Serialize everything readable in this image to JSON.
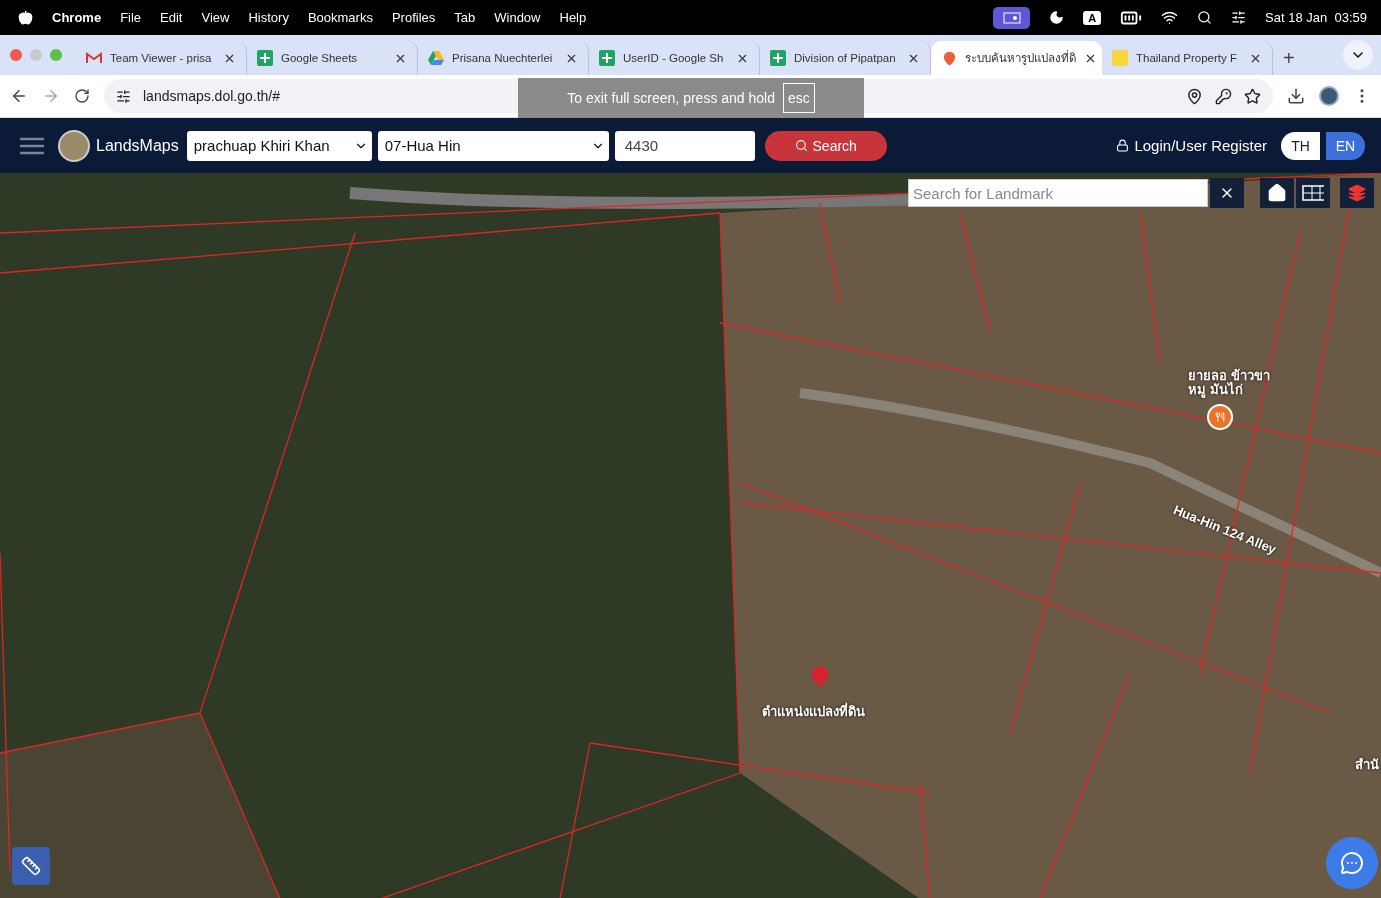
{
  "menubar": {
    "app": "Chrome",
    "menus": [
      "File",
      "Edit",
      "View",
      "History",
      "Bookmarks",
      "Profiles",
      "Tab",
      "Window",
      "Help"
    ],
    "input_badge": "A",
    "clock": "Sat 18 Jan  03:59"
  },
  "tabs": [
    {
      "kind": "gmail",
      "title": "Team Viewer - prisa",
      "selected": false
    },
    {
      "kind": "sheets",
      "title": "Google Sheets",
      "selected": false
    },
    {
      "kind": "drive",
      "title": "Prisana Nuechterlei",
      "selected": false
    },
    {
      "kind": "sheets",
      "title": "UserID - Google Sh",
      "selected": false
    },
    {
      "kind": "sheets",
      "title": "Division of Pipatpan",
      "selected": false
    },
    {
      "kind": "pin",
      "title": "ระบบค้นหารูปแปลงที่ดิ",
      "selected": true
    },
    {
      "kind": "banner",
      "title": "Thailand Property F",
      "selected": false
    }
  ],
  "new_tab": "+",
  "address": "landsmaps.dol.go.th/#",
  "fullscreen_toast": {
    "text": "To exit full screen, press and hold",
    "key": "esc"
  },
  "header": {
    "brand": "LandsMaps",
    "province": "prachuap Khiri Khan",
    "district": "07-Hua Hin",
    "parcel_number": "4430",
    "search_button": "Search",
    "login": "Login/User Register",
    "languages": [
      {
        "label": "TH",
        "selected": false
      },
      {
        "label": "EN",
        "selected": true
      }
    ]
  },
  "map": {
    "landmark_search": {
      "placeholder": "Search for Landmark"
    },
    "labels": [
      {
        "kind": "poi",
        "text": "ยายลอ ข้าวขา\nหมู มันไก่"
      },
      {
        "kind": "road",
        "text": "Hua-Hin 124 Alley"
      },
      {
        "kind": "marker",
        "text": "ตำแหน่งแปลงที่ดิน"
      },
      {
        "kind": "edge",
        "text": "สำนั"
      }
    ]
  }
}
